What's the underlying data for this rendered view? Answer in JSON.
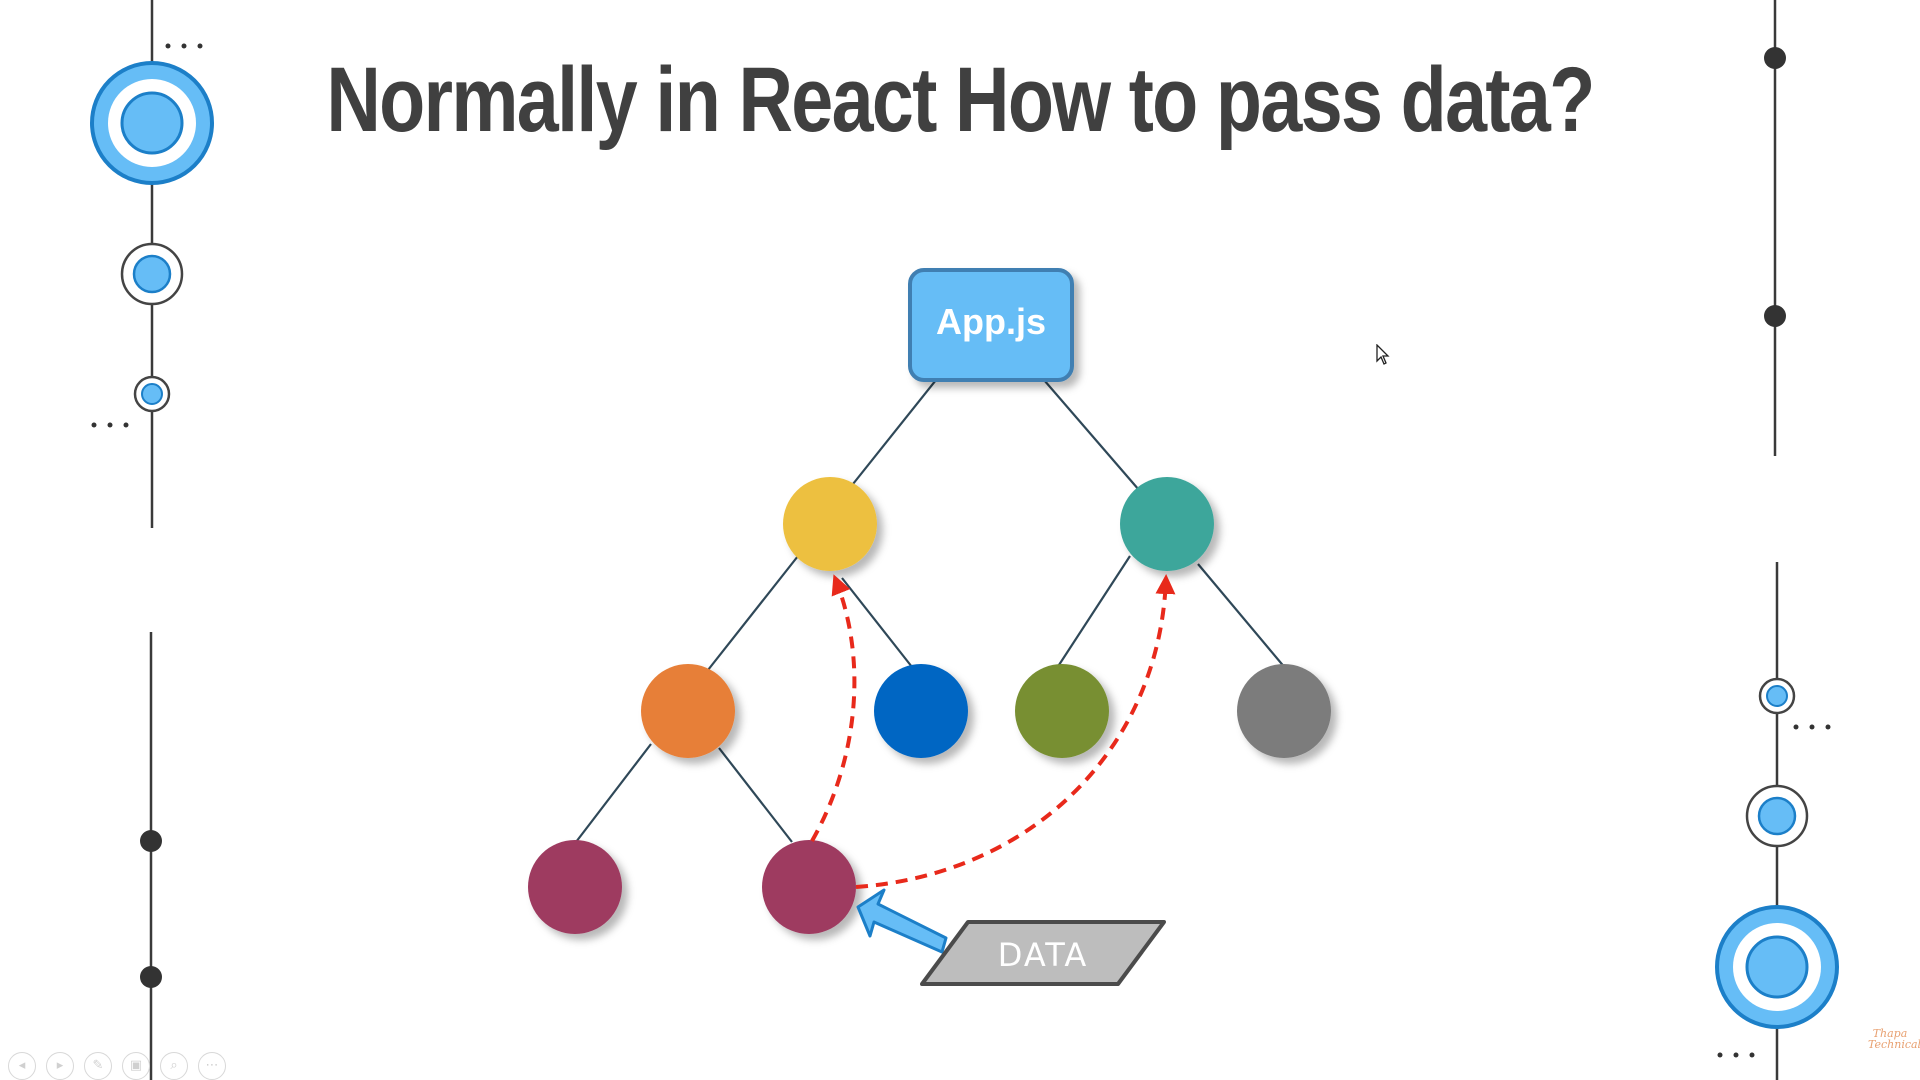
{
  "slide": {
    "title": "Normally in React How to pass data?"
  },
  "diagram": {
    "root_label": "App.js",
    "data_label": "DATA",
    "colors": {
      "root_fill": "#66bdf6",
      "root_stroke": "#3f7fb2",
      "yellow": "#edc03f",
      "teal": "#3ea69b",
      "orange": "#e77f37",
      "blue": "#0566c3",
      "olive": "#788f32",
      "gray": "#7c7c7c",
      "maroon": "#9e3a60",
      "arrow_dashed": "#e8291b",
      "data_fill": "#bdbdbd",
      "data_stroke": "#4b4b4b",
      "accent_light": "#66bdf6",
      "accent_dark": "#1c7fc8"
    }
  },
  "decor": {
    "dots": "...",
    "watermark": "Thapa Technical"
  },
  "toolbar": {
    "icons": [
      "prev-icon",
      "next-icon",
      "pen-icon",
      "slides-icon",
      "zoom-icon",
      "more-icon"
    ],
    "glyphs": [
      "◂",
      "▸",
      "✎",
      "▣",
      "⌕",
      "⋯"
    ]
  }
}
